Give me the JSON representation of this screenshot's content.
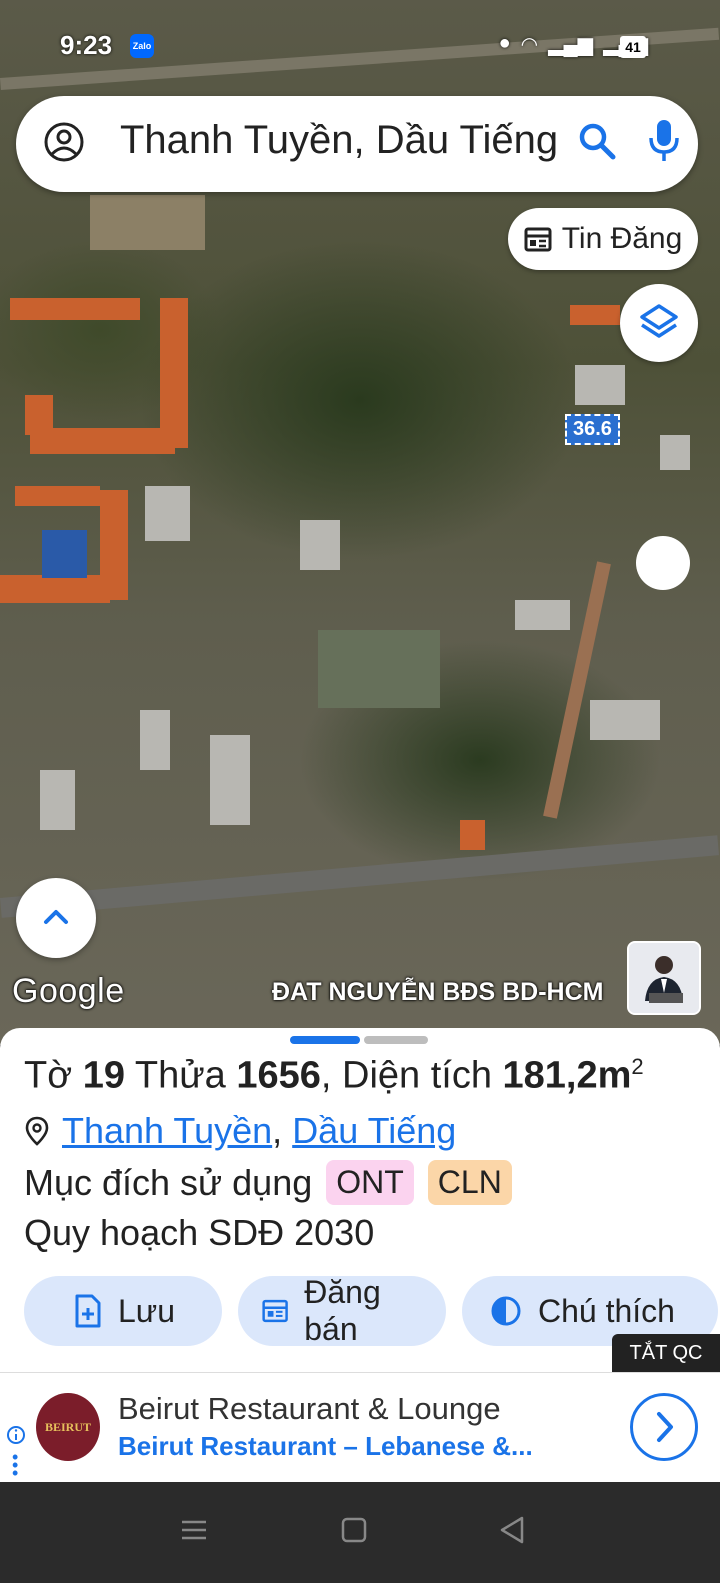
{
  "status_bar": {
    "time": "9:23",
    "zalo_label": "Zalo",
    "battery": "41",
    "icons": [
      "location-icon",
      "wifi-icon",
      "volte-icon",
      "signal-icon",
      "signal-icon-2",
      "battery-icon"
    ]
  },
  "search": {
    "value": "Thanh Tuyền, Dầu Tiếng"
  },
  "map": {
    "tin_dang_label": "Tin Đăng",
    "dimension_label": "36.6",
    "google_label": "Google",
    "watermark": "ĐAT NGUYỄN BĐS BD-HCM"
  },
  "parcel": {
    "to_label": "Tờ",
    "to_value": "19",
    "thua_label": "Thửa",
    "thua_value": "1656",
    "area_label": ", Diện tích",
    "area_value": "181,2m",
    "area_sup": "2",
    "ward": "Thanh Tuyền",
    "separator": ",",
    "district": "Dầu Tiếng",
    "purpose_label": "Mục đích sử dụng",
    "purpose_badges": [
      "ONT",
      "CLN"
    ],
    "plan": "Quy hoạch SDĐ 2030"
  },
  "actions": {
    "save": "Lưu",
    "post_sale": "Đăng bán",
    "legend": "Chú thích"
  },
  "ad": {
    "toggle": "TẮT QC",
    "logo_text": "BEIRUT",
    "title": "Beirut Restaurant & Lounge",
    "subtitle": "Beirut Restaurant – Lebanese &..."
  },
  "colors": {
    "accent": "#1a73e8",
    "chip_bg": "#dbe7fb",
    "badge_ont": "#fbd3ef",
    "badge_cln": "#fbd6a8"
  }
}
